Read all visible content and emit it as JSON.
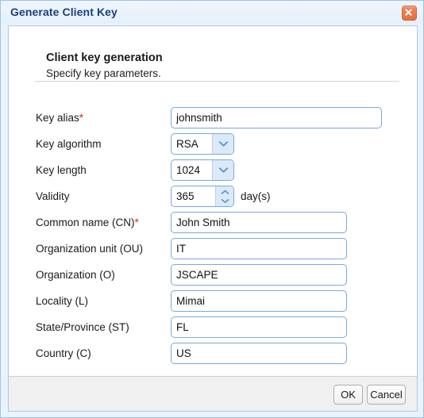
{
  "window": {
    "title": "Generate Client Key",
    "close_icon": "close-icon"
  },
  "section": {
    "heading": "Client key generation",
    "subheading": "Specify key parameters."
  },
  "fields": [
    {
      "label": "Key alias",
      "required": "*",
      "type": "text",
      "value": "johnsmith",
      "name": "key-alias"
    },
    {
      "label": "Key algorithm",
      "required": "",
      "type": "select",
      "value": "RSA",
      "name": "key-algorithm"
    },
    {
      "label": "Key length",
      "required": "",
      "type": "select",
      "value": "1024",
      "name": "key-length"
    },
    {
      "label": "Validity",
      "required": "",
      "type": "spinner",
      "value": "365",
      "suffix": "day(s)",
      "name": "validity"
    },
    {
      "label": "Common name (CN)",
      "required": "*",
      "type": "text",
      "value": "John Smith",
      "name": "common-name"
    },
    {
      "label": "Organization unit (OU)",
      "required": "",
      "type": "text",
      "value": "IT",
      "name": "organization-unit"
    },
    {
      "label": "Organization (O)",
      "required": "",
      "type": "text",
      "value": "JSCAPE",
      "name": "organization"
    },
    {
      "label": "Locality (L)",
      "required": "",
      "type": "text",
      "value": "Mimai",
      "name": "locality"
    },
    {
      "label": "State/Province (ST)",
      "required": "",
      "type": "text",
      "value": "FL",
      "name": "state-province"
    },
    {
      "label": "Country (C)",
      "required": "",
      "type": "text",
      "value": "US",
      "name": "country"
    }
  ],
  "footer": {
    "ok_label": "OK",
    "cancel_label": "Cancel"
  },
  "colors": {
    "accent_border": "#7ba7d7",
    "title_text": "#1b3f80",
    "required_marker": "#e02020",
    "close_button": "#e4713f",
    "combo_button": "#dce9f8",
    "footer_background": "#f0f0f0"
  }
}
